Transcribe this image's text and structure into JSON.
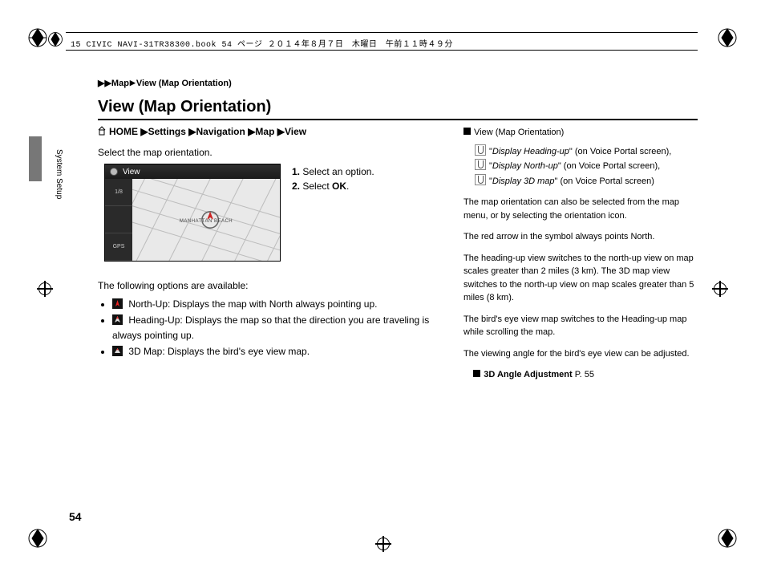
{
  "header_filename": "15 CIVIC NAVI-31TR38300.book  54 ページ  ２０１４年８月７日　木曜日　午前１１時４９分",
  "side_label": "System Setup",
  "breadcrumb": {
    "pre": "▶▶",
    "a": "Map",
    "sep": "▶",
    "b": "View (Map Orientation)"
  },
  "title": "View (Map Orientation)",
  "navpath": {
    "p1": "HOME",
    "p2": "Settings",
    "p3": "Navigation",
    "p4": "Map",
    "p5": "View"
  },
  "intro": "Select the map orientation.",
  "screenshot": {
    "toptext": "View",
    "side1": "1/8",
    "side2": "",
    "side3": "GPS",
    "maplabel": "MANHATTAN BEACH"
  },
  "steps": {
    "s1n": "1.",
    "s1": "Select an option.",
    "s2n": "2.",
    "s2t": "Select ",
    "s2b": "OK",
    "s2e": "."
  },
  "options": {
    "lead": "The following options are available:",
    "o1": " North-Up: Displays the map with North always pointing up.",
    "o2": " Heading-Up: Displays the map so that the direction you are traveling is always pointing up.",
    "o3": " 3D Map: Displays the bird's eye view map."
  },
  "right": {
    "head": "View (Map Orientation)",
    "v1a": "\"",
    "v1i": "Display Heading-up",
    "v1b": "\" (on Voice Portal screen),",
    "v2a": "\"",
    "v2i": "Display North-up",
    "v2b": "\" (on Voice Portal screen),",
    "v3a": "\"",
    "v3i": "Display 3D map",
    "v3b": "\" (on Voice Portal screen)",
    "p1": "The map orientation can also be selected from the map menu, or by selecting the orientation icon.",
    "p2": "The red arrow in the symbol always points North.",
    "p3": "The heading-up view switches to the north-up view on map scales greater than 2 miles (3 km). The 3D map view switches to the north-up view on map scales greater than 5 miles (8 km).",
    "p4": "The bird's eye view map switches to the Heading-up map while scrolling the map.",
    "p5": "The viewing angle for the bird's eye view can be adjusted.",
    "xref_t": "3D Angle Adjustment",
    "xref_p": " P. 55"
  },
  "pagenum": "54"
}
